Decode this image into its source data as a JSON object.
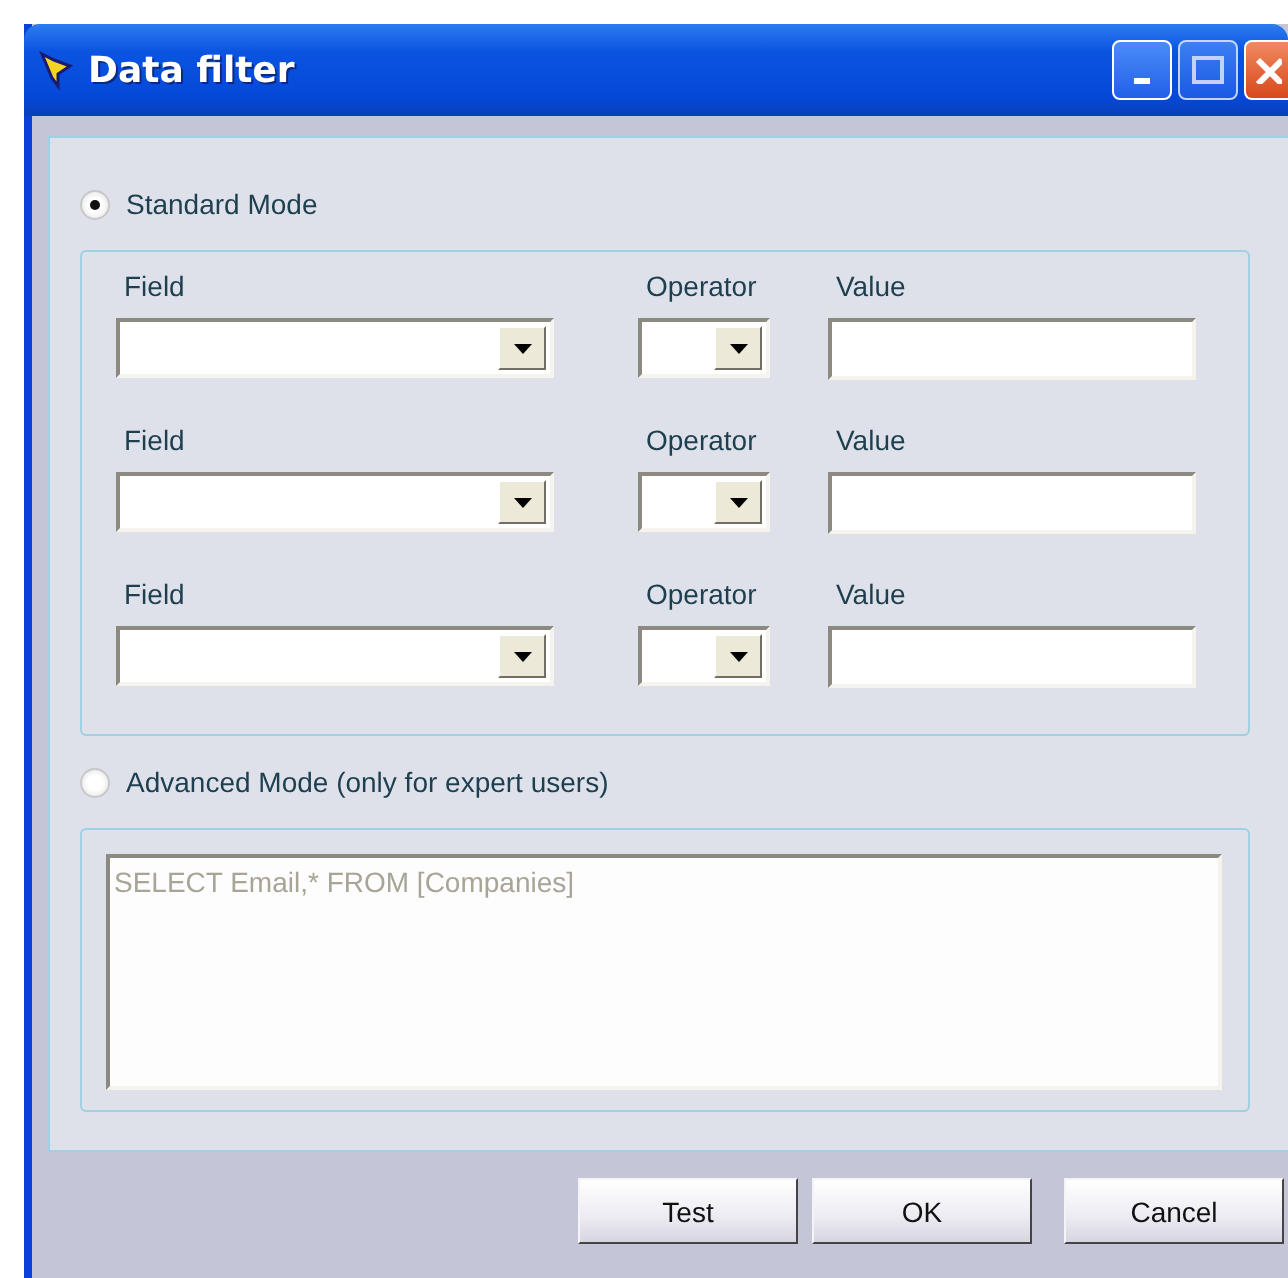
{
  "window": {
    "title": "Data filter"
  },
  "modes": [
    {
      "label": "Standard Mode",
      "selected": true
    },
    {
      "label": "Advanced Mode (only for expert users)",
      "selected": false
    }
  ],
  "conditions": [
    {
      "field_label": "Field",
      "operator_label": "Operator",
      "value_label": "Value"
    },
    {
      "field_label": "Field",
      "operator_label": "Operator",
      "value_label": "Value"
    },
    {
      "field_label": "Field",
      "operator_label": "Operator",
      "value_label": "Value"
    }
  ],
  "query": {
    "value": "SELECT Email,* FROM [Companies]",
    "disabled": true
  },
  "buttons": [
    "Test",
    "OK",
    "Cancel"
  ]
}
